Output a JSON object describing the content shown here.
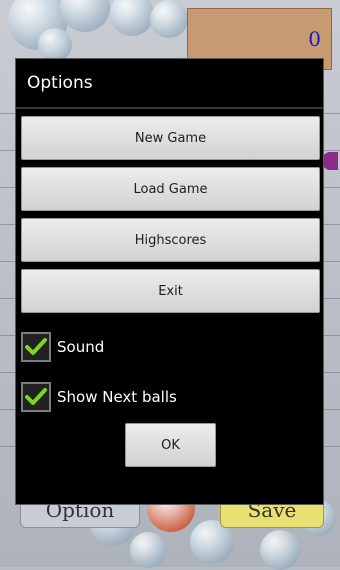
{
  "background": {
    "score": "0",
    "option_label": "Option",
    "save_label": "Save"
  },
  "dialog": {
    "title": "Options",
    "buttons": [
      "New Game",
      "Load Game",
      "Highscores",
      "Exit"
    ],
    "checkboxes": [
      {
        "label": "Sound",
        "checked": true
      },
      {
        "label": "Show Next balls",
        "checked": true
      }
    ],
    "ok_label": "OK"
  },
  "colors": {
    "check_mark": "#7fd321",
    "score_text": "#1c1cb8",
    "dialog_bg": "#000000"
  }
}
